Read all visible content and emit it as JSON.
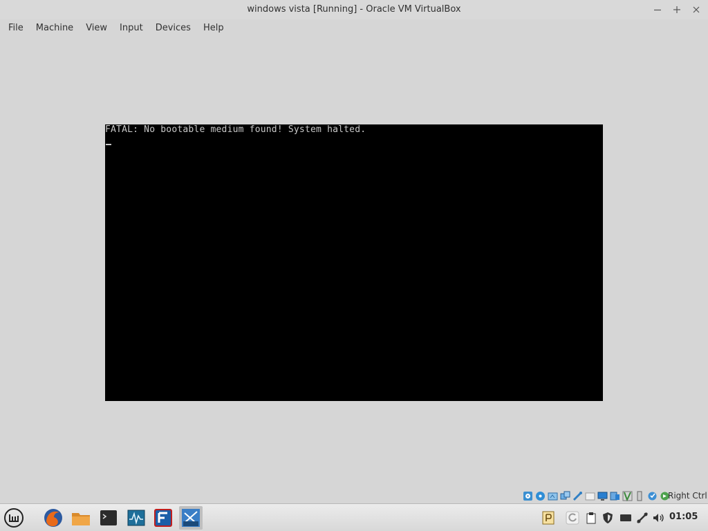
{
  "window": {
    "title": "windows vista [Running] - Oracle VM VirtualBox",
    "controls": [
      "minimize-icon",
      "maximize-icon",
      "close-icon"
    ]
  },
  "menu": {
    "items": [
      "File",
      "Machine",
      "View",
      "Input",
      "Devices",
      "Help"
    ]
  },
  "vm_console": {
    "message": "FATAL: No bootable medium found! System halted.",
    "background": "#000000",
    "text_color": "#c8c8c8"
  },
  "status_bar": {
    "icons": [
      "hard-disk-icon",
      "optical-drive-icon",
      "audio-icon",
      "network-icon",
      "usb-icon",
      "shared-folder-icon",
      "display-icon",
      "video-capture-icon",
      "mouse-integration-icon",
      "keyboard-icon",
      "cpu-icon",
      "host-key-icon"
    ],
    "host_key": "Right Ctrl"
  },
  "taskbar": {
    "launchers": [
      "mint-menu-icon",
      "firefox-icon",
      "files-icon",
      "terminal-icon",
      "system-monitor-icon",
      "filezilla-icon",
      "virtualbox-vista-icon"
    ],
    "tray_icons": [
      "pidgin-icon",
      "update-manager-icon",
      "clipboard-icon",
      "shield-icon",
      "keyboard-layout-icon",
      "network-icon",
      "volume-icon"
    ],
    "clock": "01:05"
  }
}
